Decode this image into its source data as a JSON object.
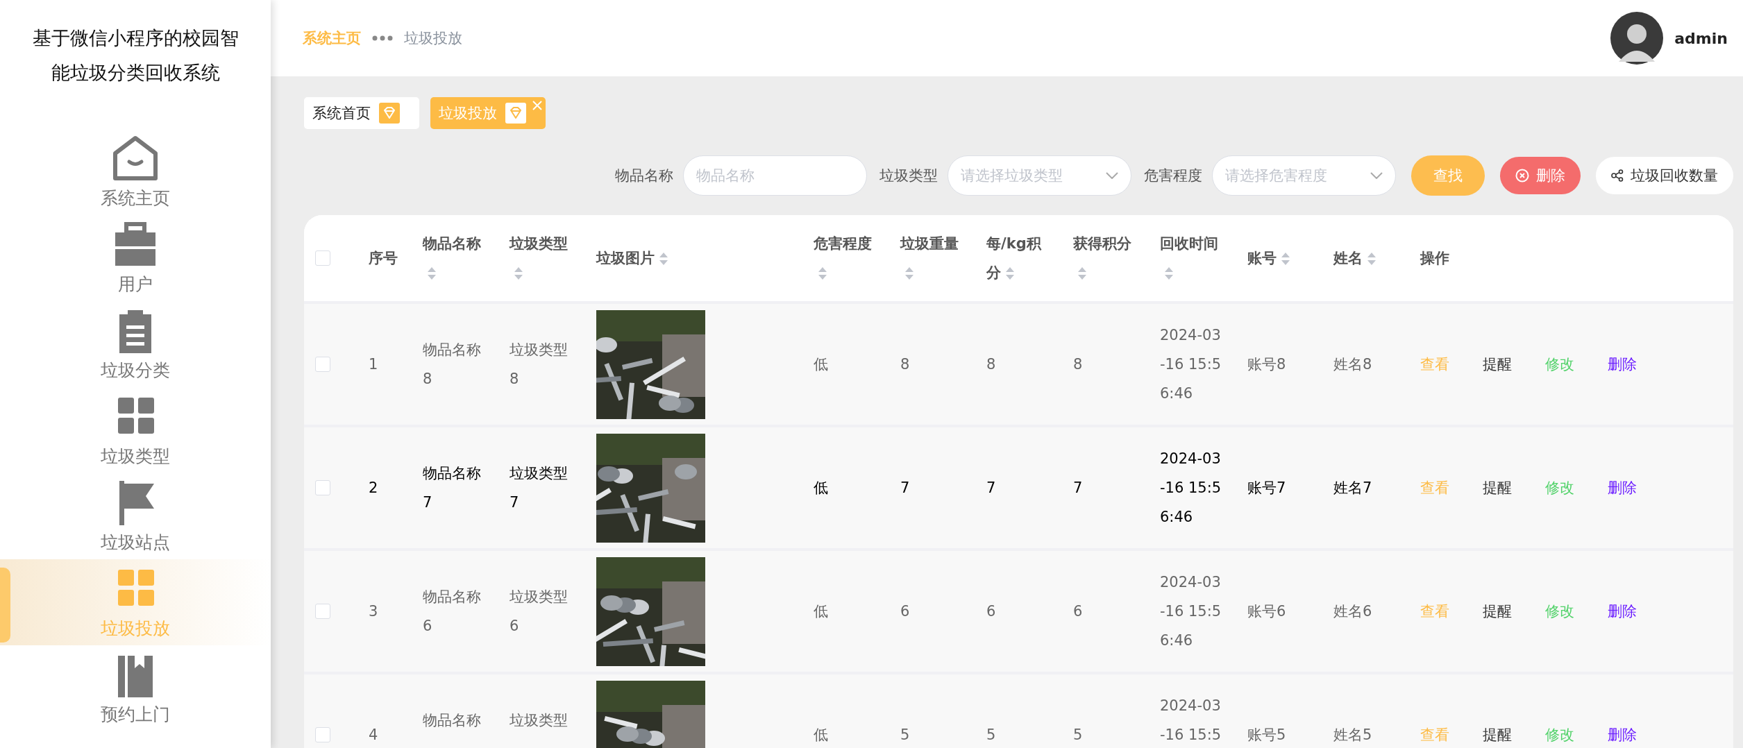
{
  "sidebar": {
    "title": "基于微信小程序的校园智能垃圾分类回收系统",
    "items": [
      {
        "label": "系统主页",
        "kind": "home",
        "selected": false
      },
      {
        "label": "用户",
        "kind": "case",
        "selected": false
      },
      {
        "label": "垃圾分类",
        "kind": "clipboard",
        "selected": false
      },
      {
        "label": "垃圾类型",
        "kind": "grid",
        "selected": false
      },
      {
        "label": "垃圾站点",
        "kind": "flag",
        "selected": false
      },
      {
        "label": "垃圾投放",
        "kind": "grid",
        "selected": true
      },
      {
        "label": "预约上门",
        "kind": "book",
        "selected": false
      }
    ]
  },
  "header": {
    "breadcrumb": [
      "系统主页",
      "垃圾投放"
    ],
    "user": "admin"
  },
  "tabs": [
    {
      "label": "系统首页",
      "selected": false,
      "closable": false
    },
    {
      "label": "垃圾投放",
      "selected": true,
      "closable": true
    }
  ],
  "filters": [
    {
      "label": "物品名称",
      "kind": "input",
      "placeholder": "物品名称"
    },
    {
      "label": "垃圾类型",
      "kind": "select",
      "placeholder": "请选择垃圾类型"
    },
    {
      "label": "危害程度",
      "kind": "select",
      "placeholder": "请选择危害程度"
    }
  ],
  "actions": [
    {
      "label": "查找",
      "kind": "search"
    },
    {
      "label": "删除",
      "kind": "delete"
    },
    {
      "label": "垃圾回收数量",
      "kind": "stats"
    }
  ],
  "table": {
    "select_all": {
      "checked": false
    },
    "columns": [
      {
        "label": "序号",
        "sortable": false
      },
      {
        "label": "物品名称",
        "sortable": true
      },
      {
        "label": "垃圾类型",
        "sortable": true
      },
      {
        "label": "垃圾图片",
        "sortable": true
      },
      {
        "label": "危害程度",
        "sortable": true
      },
      {
        "label": "垃圾重量",
        "sortable": true
      },
      {
        "label": "每/kg积分",
        "sortable": true
      },
      {
        "label": "获得积分",
        "sortable": true
      },
      {
        "label": "回收时间",
        "sortable": true
      },
      {
        "label": "账号",
        "sortable": true
      },
      {
        "label": "姓名",
        "sortable": true
      },
      {
        "label": "操作",
        "sortable": false
      }
    ],
    "rows": [
      {
        "checked": false,
        "highlighted": false,
        "cells": [
          "1",
          "物品名称8",
          "垃圾类型8",
          {
            "kind": "picture"
          },
          "低",
          "8",
          "8",
          "8",
          "2024-03-16 15:56:46",
          "账号8",
          "姓名8"
        ],
        "actions": [
          {
            "label": "查看",
            "kind": "view"
          },
          {
            "label": "提醒",
            "kind": "remind"
          },
          {
            "label": "修改",
            "kind": "edit"
          },
          {
            "label": "删除",
            "kind": "delete"
          }
        ]
      },
      {
        "checked": false,
        "highlighted": true,
        "cells": [
          "2",
          "物品名称7",
          "垃圾类型7",
          {
            "kind": "picture"
          },
          "低",
          "7",
          "7",
          "7",
          "2024-03-16 15:56:46",
          "账号7",
          "姓名7"
        ],
        "actions": [
          {
            "label": "查看",
            "kind": "view"
          },
          {
            "label": "提醒",
            "kind": "remind"
          },
          {
            "label": "修改",
            "kind": "edit"
          },
          {
            "label": "删除",
            "kind": "delete"
          }
        ]
      },
      {
        "checked": false,
        "highlighted": false,
        "cells": [
          "3",
          "物品名称6",
          "垃圾类型6",
          {
            "kind": "picture"
          },
          "低",
          "6",
          "6",
          "6",
          "2024-03-16 15:56:46",
          "账号6",
          "姓名6"
        ],
        "actions": [
          {
            "label": "查看",
            "kind": "view"
          },
          {
            "label": "提醒",
            "kind": "remind"
          },
          {
            "label": "修改",
            "kind": "edit"
          },
          {
            "label": "删除",
            "kind": "delete"
          }
        ]
      },
      {
        "checked": false,
        "highlighted": false,
        "cells": [
          "4",
          "物品名称",
          "垃圾类型",
          {
            "kind": "picture"
          },
          "低",
          "5",
          "5",
          "5",
          "2024-03-16 15:5",
          "账号5",
          "姓名5"
        ],
        "actions": [
          {
            "label": "查看",
            "kind": "view"
          },
          {
            "label": "提醒",
            "kind": "remind"
          },
          {
            "label": "修改",
            "kind": "edit"
          },
          {
            "label": "删除",
            "kind": "delete"
          }
        ]
      }
    ]
  }
}
